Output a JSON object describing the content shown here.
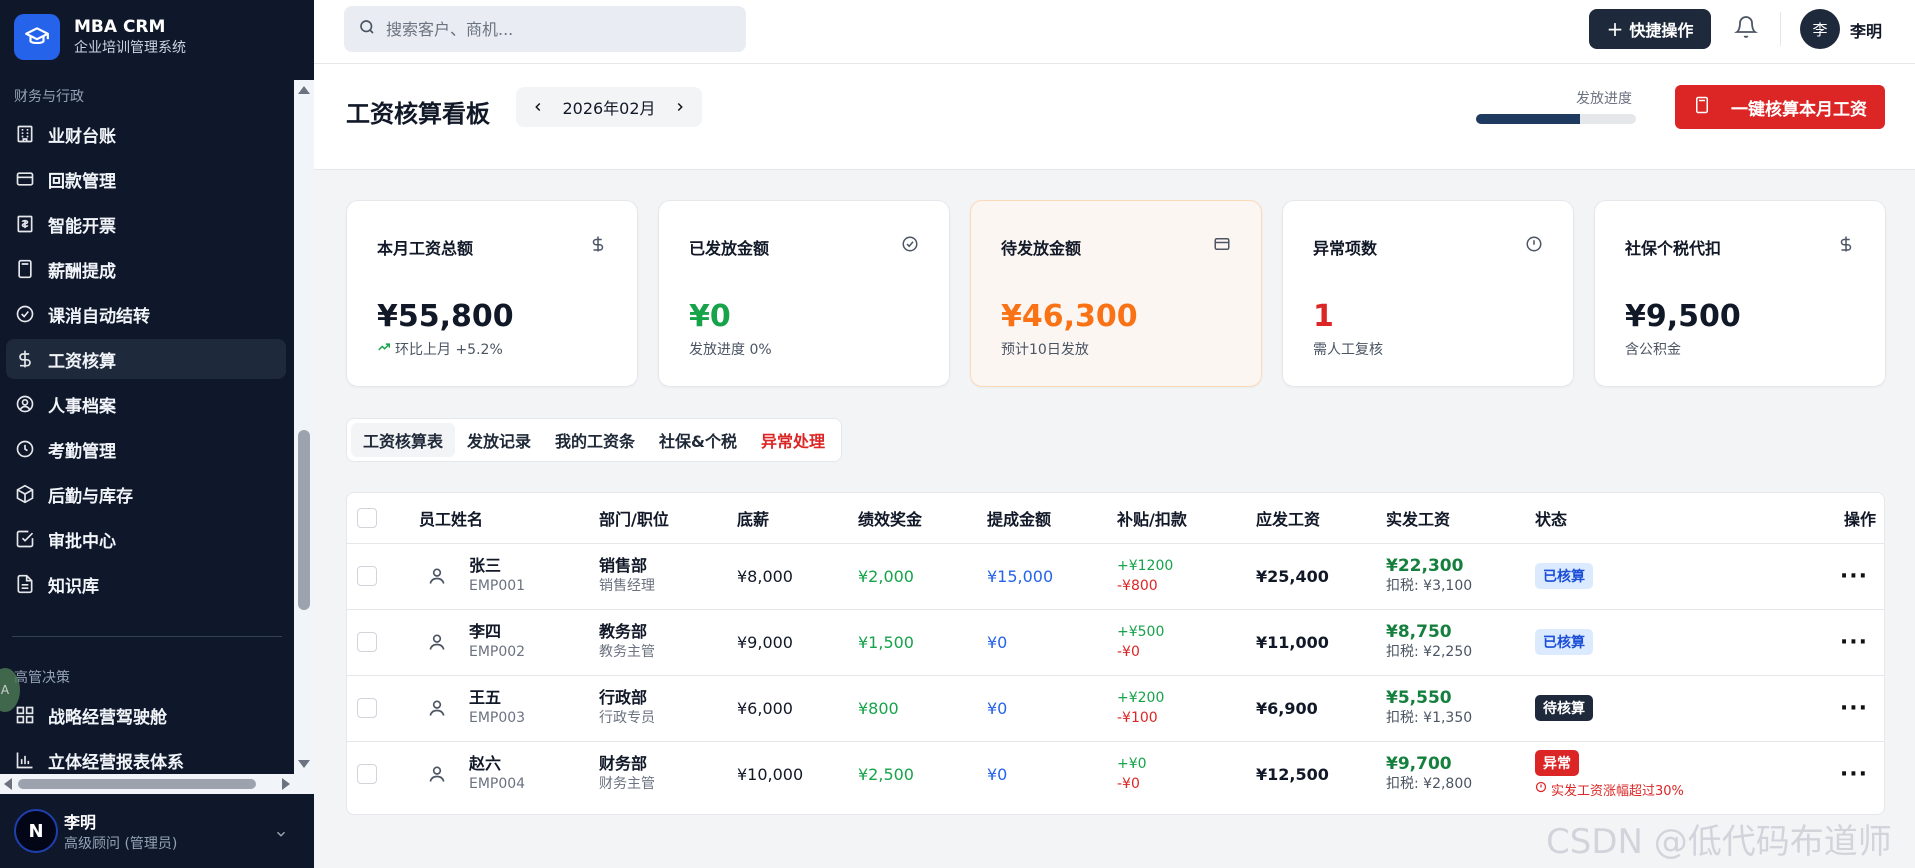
{
  "brand": {
    "name": "MBA CRM",
    "subtitle": "企业培训管理系统"
  },
  "sidebar": {
    "section_finance": "财务与行政",
    "items": [
      {
        "label": "业财台账",
        "icon": "bank-icon"
      },
      {
        "label": "回款管理",
        "icon": "card-icon"
      },
      {
        "label": "智能开票",
        "icon": "invoice-icon"
      },
      {
        "label": "薪酬提成",
        "icon": "calculator-icon"
      },
      {
        "label": "课消自动结转",
        "icon": "check-circle-icon"
      },
      {
        "label": "工资核算",
        "icon": "dollar-icon",
        "active": true
      },
      {
        "label": "人事档案",
        "icon": "user-circle-icon"
      },
      {
        "label": "考勤管理",
        "icon": "clock-icon"
      },
      {
        "label": "后勤与库存",
        "icon": "box-icon"
      },
      {
        "label": "审批中心",
        "icon": "checkbox-icon"
      },
      {
        "label": "知识库",
        "icon": "document-icon"
      }
    ],
    "section_exec": "高管决策",
    "exec_items": [
      {
        "label": "战略经营驾驶舱",
        "icon": "grid-icon"
      },
      {
        "label": "立体经营报表体系",
        "icon": "bar-chart-icon"
      }
    ],
    "user": {
      "avatar": "N",
      "name": "李明",
      "role": "高级顾问 (管理员)"
    }
  },
  "topbar": {
    "search_placeholder": "搜索客户、商机...",
    "quick_action": "快捷操作",
    "avatar_text": "李",
    "username": "李明"
  },
  "page": {
    "title": "工资核算看板",
    "month": "2026年02月",
    "progress_label": "发放进度",
    "progress_fraction": 0.65,
    "calc_button": "一键核算本月工资"
  },
  "cards": [
    {
      "title": "本月工资总额",
      "value": "¥55,800",
      "sub": "环比上月 +5.2%",
      "icon": "dollar-icon",
      "color": "#111827"
    },
    {
      "title": "已发放金额",
      "value": "¥0",
      "sub": "发放进度 0%",
      "icon": "check-circle-icon",
      "color": "#16a34a"
    },
    {
      "title": "待发放金额",
      "value": "¥46,300",
      "sub": "预计10日发放",
      "icon": "card-icon",
      "color": "#f97316"
    },
    {
      "title": "异常项数",
      "value": "1",
      "sub": "需人工复核",
      "icon": "alert-circle-icon",
      "color": "#dc2626"
    },
    {
      "title": "社保个税代扣",
      "value": "¥9,500",
      "sub": "含公积金",
      "icon": "dollar-icon",
      "color": "#111827"
    }
  ],
  "tabs": [
    "工资核算表",
    "发放记录",
    "我的工资条",
    "社保&个税",
    "异常处理"
  ],
  "table": {
    "headers": [
      "员工姓名",
      "部门/职位",
      "底薪",
      "绩效奖金",
      "提成金额",
      "补贴/扣款",
      "应发工资",
      "实发工资",
      "状态",
      "操作"
    ],
    "rows": [
      {
        "name": "张三",
        "id": "EMP001",
        "dept": "销售部",
        "title": "销售经理",
        "base": "¥8,000",
        "bonus": "¥2,000",
        "commission": "¥15,000",
        "allowance": "+¥1200",
        "deduction": "-¥800",
        "gross": "¥25,400",
        "net": "¥22,300",
        "tax": "扣税: ¥3,100",
        "status": "已核算",
        "status_type": "done",
        "warning": ""
      },
      {
        "name": "李四",
        "id": "EMP002",
        "dept": "教务部",
        "title": "教务主管",
        "base": "¥9,000",
        "bonus": "¥1,500",
        "commission": "¥0",
        "allowance": "+¥500",
        "deduction": "-¥0",
        "gross": "¥11,000",
        "net": "¥8,750",
        "tax": "扣税: ¥2,250",
        "status": "已核算",
        "status_type": "done",
        "warning": ""
      },
      {
        "name": "王五",
        "id": "EMP003",
        "dept": "行政部",
        "title": "行政专员",
        "base": "¥6,000",
        "bonus": "¥800",
        "commission": "¥0",
        "allowance": "+¥200",
        "deduction": "-¥100",
        "gross": "¥6,900",
        "net": "¥5,550",
        "tax": "扣税: ¥1,350",
        "status": "待核算",
        "status_type": "pending",
        "warning": ""
      },
      {
        "name": "赵六",
        "id": "EMP004",
        "dept": "财务部",
        "title": "财务主管",
        "base": "¥10,000",
        "bonus": "¥2,500",
        "commission": "¥0",
        "allowance": "+¥0",
        "deduction": "-¥0",
        "gross": "¥12,500",
        "net": "¥9,700",
        "tax": "扣税: ¥2,800",
        "status": "异常",
        "status_type": "abnormal",
        "warning": "实发工资涨幅超过30%"
      }
    ]
  },
  "watermark": "CSDN @低代码布道师"
}
